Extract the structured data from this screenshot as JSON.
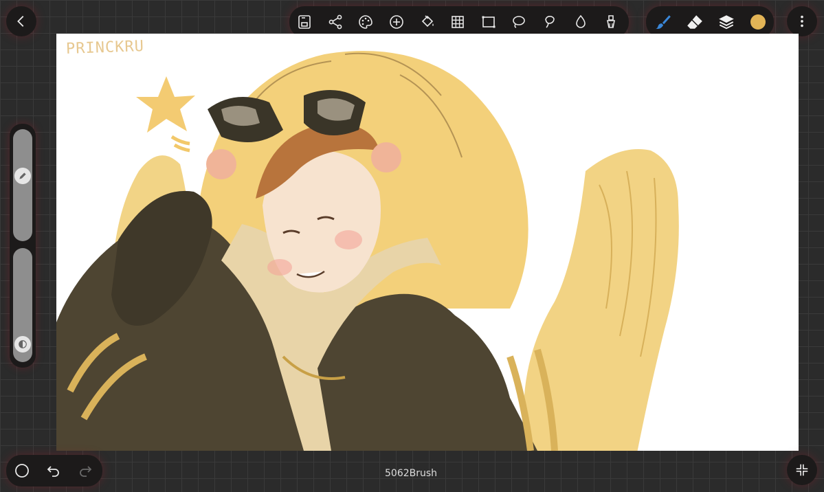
{
  "app": {
    "toolbar": {
      "tools": [
        {
          "icon": "save-icon"
        },
        {
          "icon": "share-icon"
        },
        {
          "icon": "palette-icon"
        },
        {
          "icon": "add-icon"
        },
        {
          "icon": "fill-bucket-icon"
        },
        {
          "icon": "grid-icon"
        },
        {
          "icon": "rectangle-select-icon"
        },
        {
          "icon": "lasso-select-icon"
        },
        {
          "icon": "freeform-select-icon"
        },
        {
          "icon": "blur-drop-icon"
        },
        {
          "icon": "smudge-icon"
        }
      ]
    },
    "right_tools": [
      {
        "icon": "brush-icon",
        "active": true
      },
      {
        "icon": "eraser-icon"
      },
      {
        "icon": "layers-icon"
      },
      {
        "icon": "color-swatch-icon"
      }
    ],
    "current_color": "#e2b456",
    "accent_color": "#3a87d8",
    "sliders": {
      "brush_size_level": 0.6,
      "opacity_level": 0.1
    },
    "status": {
      "brush_name": "5062Brush"
    },
    "artwork": {
      "signature": "PRINCKRU"
    }
  }
}
